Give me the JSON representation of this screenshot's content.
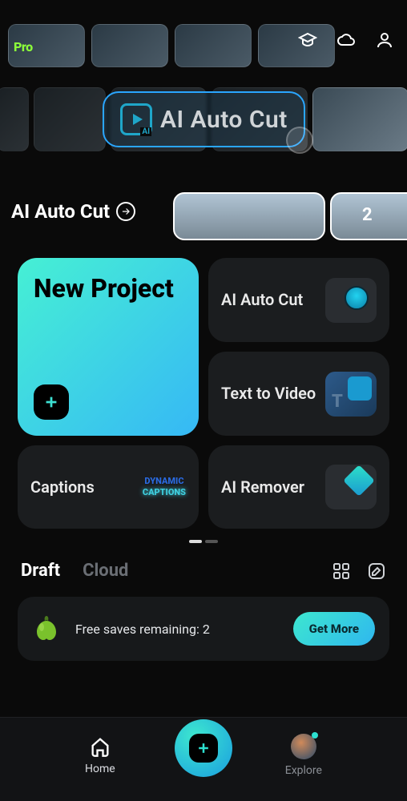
{
  "header": {
    "pro_label": "Pro"
  },
  "banner": {
    "title": "AI Auto Cut"
  },
  "carousel": {
    "title": "AI Auto Cut",
    "badge": "2"
  },
  "tools": {
    "new_project": "New Project",
    "ai_auto_cut": "AI Auto Cut",
    "text_to_video": "Text to Video",
    "captions": "Captions",
    "captions_icon_l1": "DYNAMIC",
    "captions_icon_l2": "CAPTIONS",
    "ai_remover": "AI Remover"
  },
  "tabs": {
    "draft": "Draft",
    "cloud": "Cloud"
  },
  "promo": {
    "text": "Free saves remaining: 2",
    "button": "Get More"
  },
  "nav": {
    "home": "Home",
    "explore": "Explore"
  }
}
